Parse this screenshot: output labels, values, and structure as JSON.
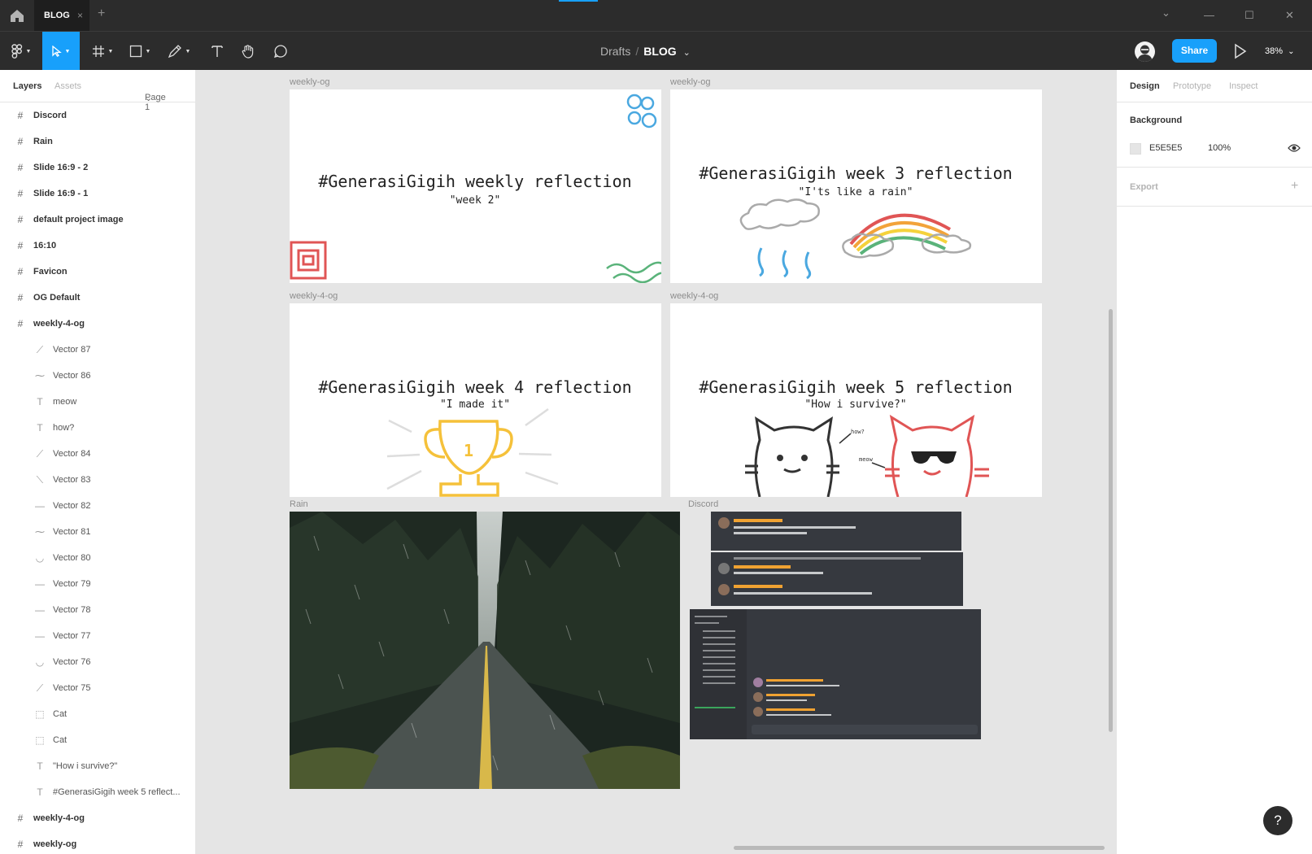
{
  "titlebar": {
    "tab_label": "BLOG",
    "tab_close": "×",
    "new_tab": "+",
    "minimize": "—",
    "maximize": "☐",
    "close": "✕",
    "chevron": "⌄"
  },
  "toolbar": {
    "breadcrumb_parent": "Drafts",
    "breadcrumb_sep": "/",
    "breadcrumb_current": "BLOG",
    "breadcrumb_caret": "⌄",
    "share_label": "Share",
    "zoom_label": "38%",
    "zoom_caret": "⌄",
    "accent": "#18a0fb"
  },
  "left_panel": {
    "tab_layers": "Layers",
    "tab_assets": "Assets",
    "page_label": "Page 1",
    "page_caret": "⌄",
    "layers": [
      {
        "label": "Discord",
        "icon": "frame-icon",
        "glyph": "#",
        "level": "top"
      },
      {
        "label": "Rain",
        "icon": "frame-icon",
        "glyph": "#",
        "level": "top"
      },
      {
        "label": "Slide 16:9 - 2",
        "icon": "frame-icon",
        "glyph": "#",
        "level": "top"
      },
      {
        "label": "Slide 16:9 - 1",
        "icon": "frame-icon",
        "glyph": "#",
        "level": "top"
      },
      {
        "label": "default project image",
        "icon": "frame-icon",
        "glyph": "#",
        "level": "top"
      },
      {
        "label": "16:10",
        "icon": "frame-icon",
        "glyph": "#",
        "level": "top"
      },
      {
        "label": "Favicon",
        "icon": "frame-icon",
        "glyph": "#",
        "level": "top"
      },
      {
        "label": "OG Default",
        "icon": "frame-icon",
        "glyph": "#",
        "level": "top"
      },
      {
        "label": "weekly-4-og",
        "icon": "frame-icon",
        "glyph": "#",
        "level": "top"
      },
      {
        "label": "Vector 87",
        "icon": "vector-icon",
        "glyph": "⟋",
        "level": "child"
      },
      {
        "label": "Vector 86",
        "icon": "vector-icon",
        "glyph": "⁓",
        "level": "child"
      },
      {
        "label": "meow",
        "icon": "text-icon",
        "glyph": "T",
        "level": "child"
      },
      {
        "label": "how?",
        "icon": "text-icon",
        "glyph": "T",
        "level": "child"
      },
      {
        "label": "Vector 84",
        "icon": "vector-icon",
        "glyph": "⟋",
        "level": "child"
      },
      {
        "label": "Vector 83",
        "icon": "vector-icon",
        "glyph": "⟍",
        "level": "child"
      },
      {
        "label": "Vector 82",
        "icon": "vector-icon",
        "glyph": "—",
        "level": "child"
      },
      {
        "label": "Vector 81",
        "icon": "vector-icon",
        "glyph": "⁓",
        "level": "child"
      },
      {
        "label": "Vector 80",
        "icon": "vector-icon",
        "glyph": "◡",
        "level": "child"
      },
      {
        "label": "Vector 79",
        "icon": "vector-icon",
        "glyph": "—",
        "level": "child"
      },
      {
        "label": "Vector 78",
        "icon": "vector-icon",
        "glyph": "—",
        "level": "child"
      },
      {
        "label": "Vector 77",
        "icon": "vector-icon",
        "glyph": "—",
        "level": "child"
      },
      {
        "label": "Vector 76",
        "icon": "vector-icon",
        "glyph": "◡",
        "level": "child"
      },
      {
        "label": "Vector 75",
        "icon": "vector-icon",
        "glyph": "⟋",
        "level": "child"
      },
      {
        "label": "Cat",
        "icon": "group-icon",
        "glyph": "⬚",
        "level": "child"
      },
      {
        "label": "Cat",
        "icon": "group-icon",
        "glyph": "⬚",
        "level": "child"
      },
      {
        "label": "\"How i survive?\"",
        "icon": "text-icon",
        "glyph": "T",
        "level": "child"
      },
      {
        "label": "#GenerasiGigih week 5 reflect...",
        "icon": "text-icon",
        "glyph": "T",
        "level": "child"
      },
      {
        "label": "weekly-4-og",
        "icon": "frame-icon",
        "glyph": "#",
        "level": "top"
      },
      {
        "label": "weekly-og",
        "icon": "frame-icon",
        "glyph": "#",
        "level": "top"
      }
    ]
  },
  "right_panel": {
    "tab_design": "Design",
    "tab_prototype": "Prototype",
    "tab_inspect": "Inspect",
    "background_title": "Background",
    "background_hex": "E5E5E5",
    "background_opacity": "100%",
    "export_title": "Export",
    "export_add": "+"
  },
  "canvas": {
    "frames": [
      {
        "label": "weekly-og",
        "title": "#GenerasiGigih weekly reflection",
        "subtitle": "\"week 2\""
      },
      {
        "label": "weekly-og",
        "title": "#GenerasiGigih week 3 reflection",
        "subtitle": "\"I'ts like a rain\""
      },
      {
        "label": "weekly-4-og",
        "title": "#GenerasiGigih week 4 reflection",
        "subtitle": "\"I made it\""
      },
      {
        "label": "weekly-4-og",
        "title": "#GenerasiGigih week 5 reflection",
        "subtitle": "\"How i survive?\"",
        "cat_text_1": "how?",
        "cat_text_2": "meow"
      },
      {
        "label": "Rain"
      },
      {
        "label": "Discord"
      }
    ],
    "trophy_number": "1"
  },
  "help_label": "?"
}
